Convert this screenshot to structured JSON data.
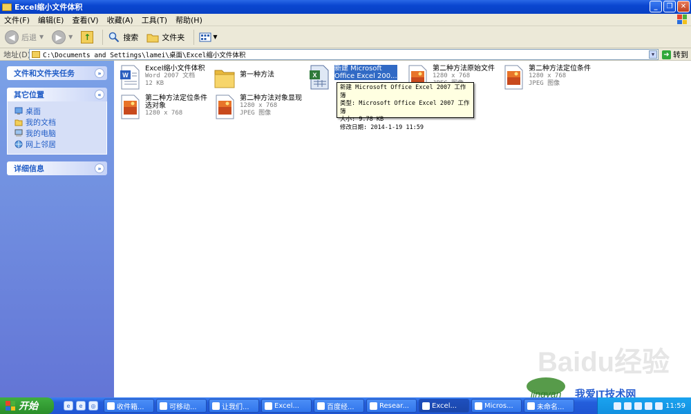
{
  "window": {
    "title": "Excel缩小文件体积"
  },
  "menu": [
    "文件(F)",
    "编辑(E)",
    "查看(V)",
    "收藏(A)",
    "工具(T)",
    "帮助(H)"
  ],
  "toolbar": {
    "back": "后退",
    "search": "搜索",
    "folders": "文件夹"
  },
  "address": {
    "label": "地址(D)",
    "path": "C:\\Documents and Settings\\lamei\\桌面\\Excel缩小文件体积",
    "go": "转到"
  },
  "left_pane": {
    "tasks_title": "文件和文件夹任务",
    "other_places_title": "其它位置",
    "other_places": [
      "桌面",
      "我的文档",
      "我的电脑",
      "网上邻居"
    ],
    "details_title": "详细信息"
  },
  "files": [
    {
      "name": "Excel缩小文件体积",
      "sub1": "Word 2007 文档",
      "sub2": "12 KB",
      "icon": "word-doc-icon"
    },
    {
      "name": "第一种方法",
      "sub1": "",
      "sub2": "",
      "icon": "folder-icon"
    },
    {
      "name": "新建 Microsoft",
      "name2": "Office Excel 200...",
      "sub1": "",
      "sub2": "",
      "icon": "excel-doc-icon"
    },
    {
      "name": "第二种方法原始文件",
      "sub1": "1280 x 768",
      "sub2": "JPEG 图像",
      "icon": "jpeg-image-icon"
    },
    {
      "name": "第二种方法定位条件",
      "sub1": "1280 x 768",
      "sub2": "JPEG 图像",
      "icon": "jpeg-image-icon"
    },
    {
      "name": "第二种方法定位条件",
      "name2": "选对象",
      "sub1": "1280 x 768",
      "sub2": "",
      "icon": "jpeg-image-icon"
    },
    {
      "name": "第二种方法对象显现",
      "sub1": "1280 x 768",
      "sub2": "JPEG 图像",
      "icon": "jpeg-image-icon"
    }
  ],
  "tooltip": {
    "line1": "新建 Microsoft Office Excel 2007 工作簿",
    "line2": "类型: Microsoft Office Excel 2007 工作簿",
    "line3": "大小: 9.78 KB",
    "line4": "修改日期: 2014-1-19 11:59"
  },
  "taskbar": {
    "start": "开始",
    "tasks": [
      "收件箱...",
      "可移动...",
      "让我们...",
      "Excel...",
      "百度经...",
      "Resear...",
      "Excel...",
      "Micros...",
      "未命名..."
    ],
    "clock": "11:59"
  },
  "watermark": {
    "brand": "Baidu经验",
    "sub": "jingyan",
    "slogan": "我爱IT技术网"
  },
  "colors": {
    "xp_blue": "#0a46d0",
    "task_pane": "#7ba2e7",
    "selection": "#316ac5",
    "tooltip_bg": "#ffffe1"
  }
}
